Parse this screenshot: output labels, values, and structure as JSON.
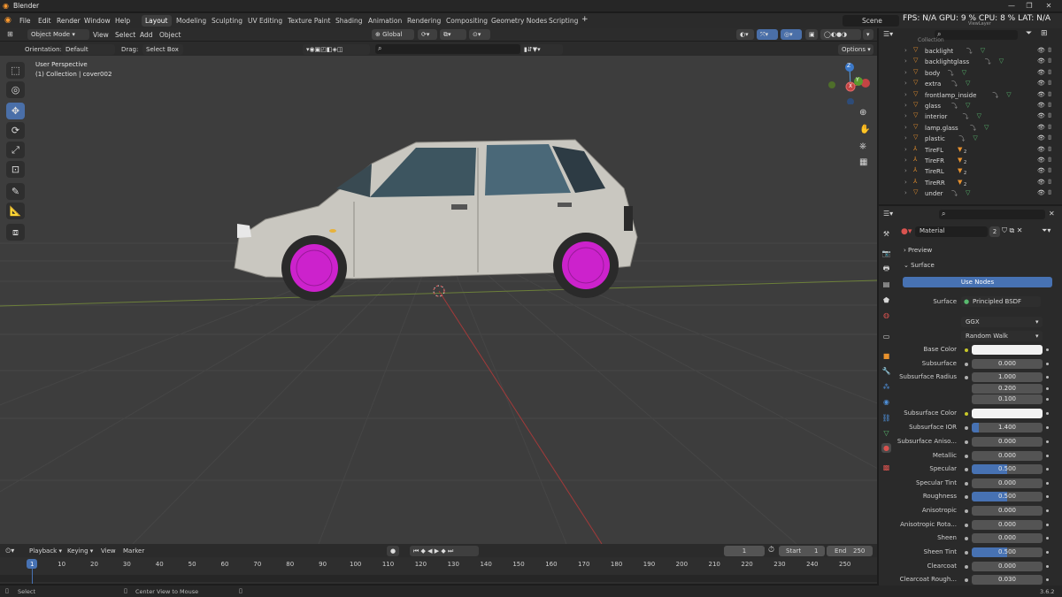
{
  "app": {
    "title": "Blender",
    "version": "3.6.2"
  },
  "menu": [
    "File",
    "Edit",
    "Render",
    "Window",
    "Help"
  ],
  "workspaces": [
    "Layout",
    "Modeling",
    "Sculpting",
    "UV Editing",
    "Texture Paint",
    "Shading",
    "Animation",
    "Rendering",
    "Compositing",
    "Geometry Nodes",
    "Scripting"
  ],
  "topright": {
    "scene": "Scene",
    "stats": "FPS: N/A GPU: 9 % CPU: 8 % LAT: N/A",
    "view_layer": "ViewLayer"
  },
  "viewport_header": {
    "mode": "Object Mode",
    "view": "View",
    "select": "Select",
    "add": "Add",
    "object": "Object",
    "transform": "Global"
  },
  "tool_settings": {
    "orientation_label": "Orientation:",
    "orientation": "Default",
    "drag_label": "Drag:",
    "drag": "Select Box",
    "options": "Options"
  },
  "overlay_text": {
    "perspective": "User Perspective",
    "collection": "(1) Collection | cover002"
  },
  "gizmo": {
    "z": "Z",
    "y": "Y",
    "x": "X"
  },
  "outliner": {
    "collection": "Collection",
    "items": [
      "backlight",
      "backlightglass",
      "body",
      "extra",
      "frontlamp_inside",
      "glass",
      "interior",
      "lamp.glass",
      "plastic",
      "TireFL",
      "TireFR",
      "TireRL",
      "TireRR",
      "under"
    ],
    "subcounts": [
      "",
      "",
      "",
      "",
      "",
      "",
      "",
      "",
      "",
      "2",
      "2",
      "2",
      "2",
      ""
    ]
  },
  "properties": {
    "material_name": "Material",
    "user_count": "2",
    "preview": "Preview",
    "surface_panel": "Surface",
    "use_nodes": "Use Nodes",
    "surface_label": "Surface",
    "surface_value": "Principled BSDF",
    "distribution": "GGX",
    "subsurface_method": "Random Walk",
    "rows": [
      {
        "label": "Base Color",
        "value": "",
        "kind": "color"
      },
      {
        "label": "Subsurface",
        "value": "0.000",
        "kind": "num"
      },
      {
        "label": "Subsurface Radius",
        "value": "1.000",
        "kind": "num"
      },
      {
        "label": "",
        "value": "0.200",
        "kind": "num"
      },
      {
        "label": "",
        "value": "0.100",
        "kind": "num"
      },
      {
        "label": "Subsurface Color",
        "value": "",
        "kind": "color"
      },
      {
        "label": "Subsurface IOR",
        "value": "1.400",
        "kind": "num"
      },
      {
        "label": "Subsurface Aniso...",
        "value": "0.000",
        "kind": "num"
      },
      {
        "label": "Metallic",
        "value": "0.000",
        "kind": "num"
      },
      {
        "label": "Specular",
        "value": "0.500",
        "kind": "slider"
      },
      {
        "label": "Specular Tint",
        "value": "0.000",
        "kind": "num"
      },
      {
        "label": "Roughness",
        "value": "0.500",
        "kind": "slider"
      },
      {
        "label": "Anisotropic",
        "value": "0.000",
        "kind": "num"
      },
      {
        "label": "Anisotropic Rota...",
        "value": "0.000",
        "kind": "num"
      },
      {
        "label": "Sheen",
        "value": "0.000",
        "kind": "num"
      },
      {
        "label": "Sheen Tint",
        "value": "0.500",
        "kind": "slider"
      },
      {
        "label": "Clearcoat",
        "value": "0.000",
        "kind": "num"
      },
      {
        "label": "Clearcoat Rough...",
        "value": "0.030",
        "kind": "num"
      }
    ],
    "slider_fill": {
      "Specular": 0.5,
      "Roughness": 0.5,
      "Sheen Tint": 0.5,
      "Subsurface IOR": 0.1
    }
  },
  "timeline": {
    "playback": "Playback",
    "keying": "Keying",
    "view": "View",
    "marker": "Marker",
    "current_frame": "1",
    "start_label": "Start",
    "start": "1",
    "end_label": "End",
    "end": "250",
    "ticks": [
      "1",
      "10",
      "20",
      "30",
      "40",
      "50",
      "60",
      "70",
      "80",
      "90",
      "100",
      "110",
      "120",
      "130",
      "140",
      "150",
      "160",
      "170",
      "180",
      "190",
      "200",
      "210",
      "220",
      "230",
      "240",
      "250"
    ]
  },
  "status": {
    "select": "Select",
    "center": "Center View to Mouse"
  },
  "colors": {
    "accent": "#4772b3",
    "rim": "#cc22cc",
    "car": "#c9c7c0"
  }
}
